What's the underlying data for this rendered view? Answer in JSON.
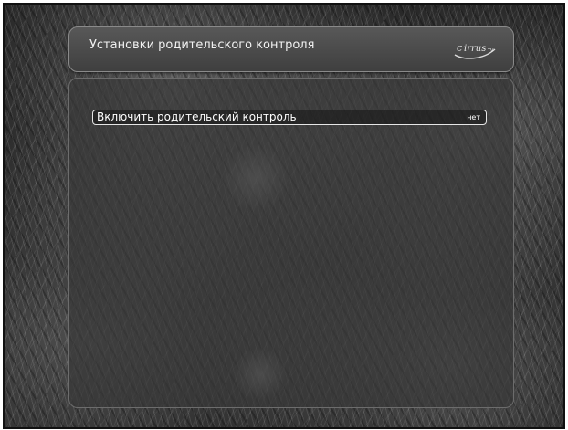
{
  "header": {
    "title": "Установки родительского контроля",
    "logo_icon": "cirrus-tv-logo"
  },
  "options": [
    {
      "label": "Включить родительский контроль",
      "value": "нет"
    }
  ],
  "colors": {
    "panel": "#4a4a4a",
    "text": "#ffffff",
    "highlight_border": "#e6e6e6"
  }
}
